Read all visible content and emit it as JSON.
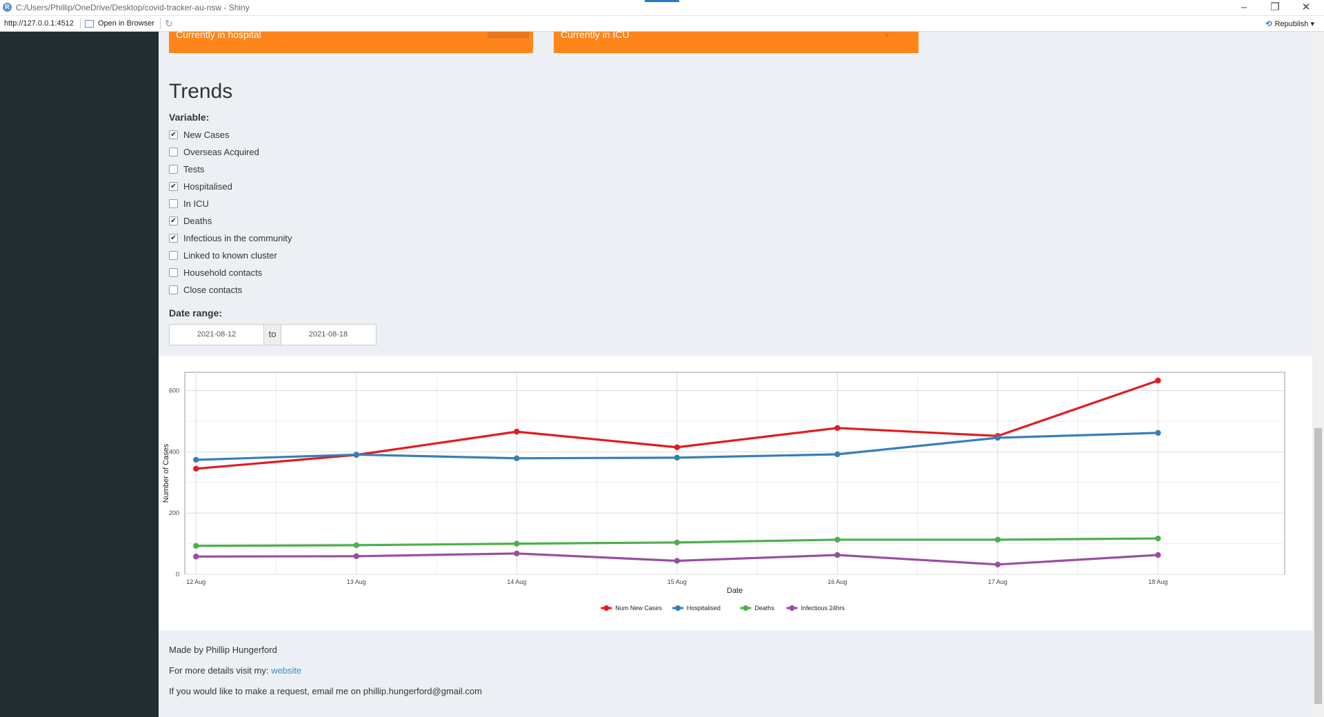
{
  "window": {
    "title": "C:/Users/Phillip/OneDrive/Desktop/covid-tracker-au-nsw - Shiny",
    "logo_letter": "R",
    "controls": [
      "–",
      "❐",
      "✕"
    ]
  },
  "toolbar": {
    "url": "http://127.0.0.1:4512",
    "open_in_browser": "Open in Browser",
    "republish": "Republish"
  },
  "info_boxes": [
    {
      "label": "Currently in hospital",
      "color": "#ff851b"
    },
    {
      "label": "Currently in ICU",
      "color": "#ff851b"
    }
  ],
  "trends": {
    "heading": "Trends",
    "variable_label": "Variable:",
    "variables": [
      {
        "label": "New Cases",
        "checked": true
      },
      {
        "label": "Overseas Acquired",
        "checked": false
      },
      {
        "label": "Tests",
        "checked": false
      },
      {
        "label": "Hospitalised",
        "checked": true
      },
      {
        "label": "In ICU",
        "checked": false
      },
      {
        "label": "Deaths",
        "checked": true
      },
      {
        "label": "Infectious in the community",
        "checked": true
      },
      {
        "label": "Linked to known cluster",
        "checked": false
      },
      {
        "label": "Household contacts",
        "checked": false
      },
      {
        "label": "Close contacts",
        "checked": false
      }
    ],
    "date_range_label": "Date range:",
    "date_start": "2021-08-12",
    "date_to": "to",
    "date_end": "2021-08-18"
  },
  "chart_data": {
    "type": "line",
    "xlabel": "Date",
    "ylabel": "Number of Cases",
    "categories": [
      "12 Aug",
      "13 Aug",
      "14 Aug",
      "15 Aug",
      "16 Aug",
      "17 Aug",
      "18 Aug"
    ],
    "ylim": [
      0,
      660
    ],
    "yticks": [
      0,
      200,
      400,
      600
    ],
    "grid": true,
    "legend_position": "bottom",
    "series": [
      {
        "name": "Num New Cases",
        "color": "#e41a1c",
        "values": [
          345,
          390,
          466,
          415,
          478,
          452,
          633
        ]
      },
      {
        "name": "Hospitalised",
        "color": "#377eb8",
        "values": [
          374,
          391,
          379,
          381,
          392,
          446,
          462
        ]
      },
      {
        "name": "Deaths",
        "color": "#4daf4a",
        "values": [
          93,
          95,
          100,
          104,
          113,
          113,
          117
        ]
      },
      {
        "name": "Infectious 24hrs",
        "color": "#984ea3",
        "values": [
          58,
          59,
          68,
          44,
          63,
          32,
          63
        ]
      }
    ]
  },
  "footer": {
    "made_by": "Made by Phillip Hungerford",
    "details_prefix": "For more details visit my: ",
    "details_link": "website",
    "request": "If you would like to make a request, email me on phillip.hungerford@gmail.com"
  }
}
